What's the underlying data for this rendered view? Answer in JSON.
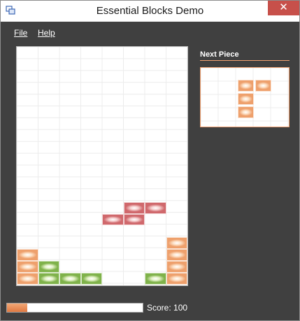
{
  "window": {
    "title": "Essential Blocks Demo",
    "close_glyph": "✕"
  },
  "menu": {
    "items": [
      {
        "label": "File",
        "underline": "F"
      },
      {
        "label": "Help",
        "underline": "H"
      }
    ]
  },
  "board": {
    "columns": 8,
    "rows": 11,
    "cells": [
      {
        "row": 5,
        "col": 5,
        "color": "red"
      },
      {
        "row": 5,
        "col": 6,
        "color": "red"
      },
      {
        "row": 6,
        "col": 4,
        "color": "red"
      },
      {
        "row": 6,
        "col": 5,
        "color": "red"
      },
      {
        "row": 8,
        "col": 7,
        "color": "orange"
      },
      {
        "row": 9,
        "col": 0,
        "color": "orange"
      },
      {
        "row": 9,
        "col": 7,
        "color": "orange"
      },
      {
        "row": 10,
        "col": 0,
        "color": "orange"
      },
      {
        "row": 10,
        "col": 1,
        "color": "green"
      },
      {
        "row": 10,
        "col": 7,
        "color": "orange"
      },
      {
        "row": 11,
        "col": 0,
        "color": "orange"
      },
      {
        "row": 11,
        "col": 1,
        "color": "green"
      },
      {
        "row": 11,
        "col": 2,
        "color": "green"
      },
      {
        "row": 11,
        "col": 3,
        "color": "green"
      },
      {
        "row": 11,
        "col": 6,
        "color": "green"
      },
      {
        "row": 11,
        "col": 7,
        "color": "orange"
      }
    ]
  },
  "next_piece": {
    "title": "Next Piece",
    "cells": [
      {
        "row": 1,
        "col": 2,
        "color": "orange"
      },
      {
        "row": 1,
        "col": 3,
        "color": "orange"
      },
      {
        "row": 2,
        "col": 2,
        "color": "orange"
      },
      {
        "row": 3,
        "col": 2,
        "color": "orange"
      }
    ]
  },
  "status": {
    "progress_fraction": 0.15,
    "score_label": "Score: 100"
  },
  "colors": {
    "orange": "#eea06c",
    "orange_light": "#fde2c8",
    "red": "#d0686c",
    "red_light": "#f6d2d2",
    "green": "#7fb24a",
    "green_light": "#e4f2c8"
  },
  "icons": {
    "app": "app-window-icon",
    "close": "close-icon"
  }
}
